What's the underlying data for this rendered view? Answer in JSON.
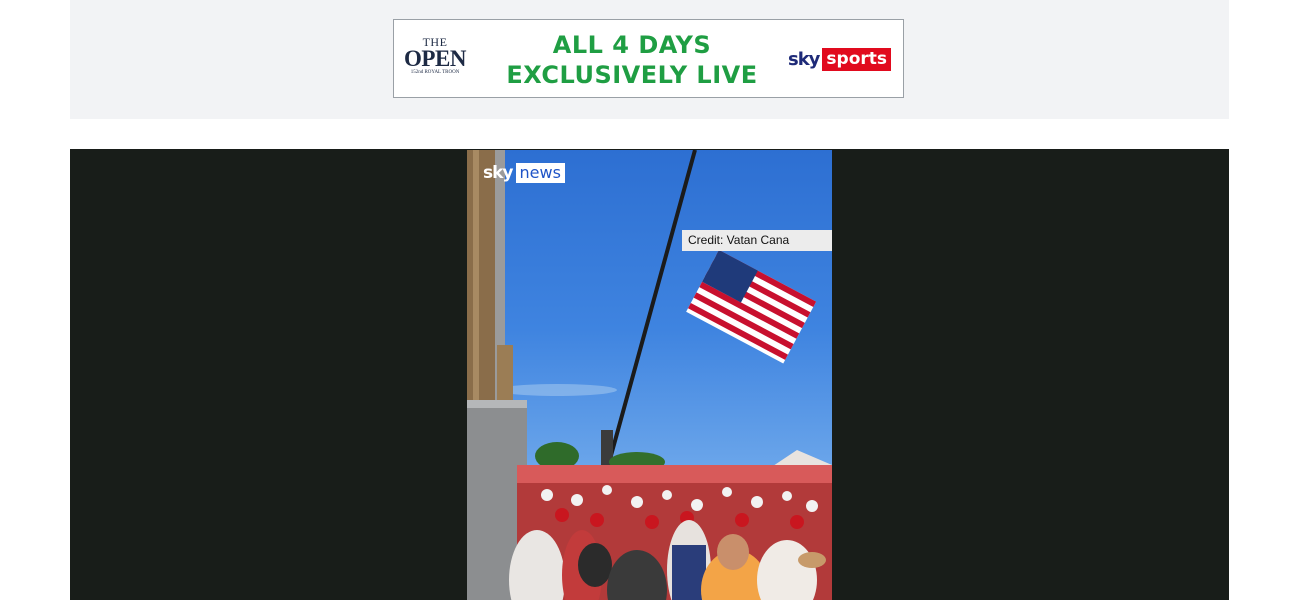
{
  "ad": {
    "sponsor_logo": {
      "the": "THE",
      "open": "OPEN",
      "sub": "152nd ROYAL TROON"
    },
    "headline_line1": "ALL 4 DAYS",
    "headline_line2": "EXCLUSIVELY LIVE",
    "broadcaster_sky": "sky",
    "broadcaster_sports": "sports",
    "colors": {
      "headline": "#1f9e43",
      "sports_red": "#e10a1e",
      "sky_navy": "#1e2a78"
    }
  },
  "video": {
    "channel_sky": "sky",
    "channel_news": "news",
    "credit": "Credit: Vatan Cana",
    "colors": {
      "background": "#181d19",
      "news_blue": "#1f54c7"
    }
  }
}
